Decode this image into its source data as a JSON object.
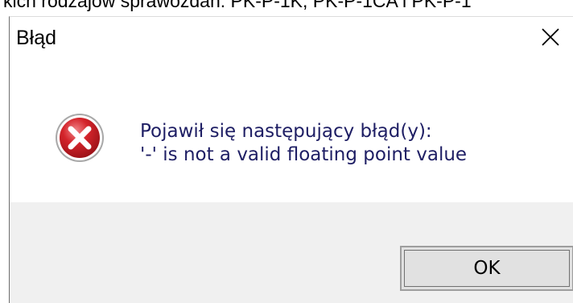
{
  "background": {
    "visible_text": "kich rodzajów sprawozdań: PK-P-1K, PK-P-1CA i PK-P-1"
  },
  "dialog": {
    "title": "Błąd",
    "close_icon": "close-icon",
    "icon": "error-icon",
    "message_lines": [
      "Pojawił się następujący błąd(y):",
      "'-' is not a valid floating point value"
    ],
    "ok_label": "OK"
  },
  "colors": {
    "error_red": "#d4242b",
    "message_text": "#1e1e64",
    "footer_bg": "#f0f0f0",
    "button_bg": "#e1e1e1"
  }
}
